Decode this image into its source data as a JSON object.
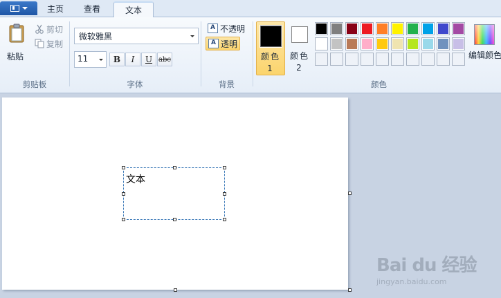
{
  "tabs": [
    {
      "label": "主页"
    },
    {
      "label": "查看"
    },
    {
      "label": "文本"
    }
  ],
  "clipboard": {
    "paste": "粘贴",
    "cut": "剪切",
    "copy": "复制",
    "group_label": "剪贴板"
  },
  "font": {
    "name": "微软雅黑",
    "size": "11",
    "bold": "B",
    "italic": "I",
    "underline": "U",
    "strikethrough": "abc",
    "group_label": "字体"
  },
  "background": {
    "opaque": "不透明",
    "transparent": "透明",
    "selected": "transparent",
    "group_label": "背景"
  },
  "colors": {
    "color1_label": "颜色 1",
    "color2_label": "颜色 2",
    "color1": "#000000",
    "color2": "#ffffff",
    "palette_row1": [
      "#000000",
      "#7f7f7f",
      "#880015",
      "#ed1c24",
      "#ff7f27",
      "#fff200",
      "#22b14c",
      "#00a2e8",
      "#3f48cc",
      "#a349a4"
    ],
    "palette_row2": [
      "#ffffff",
      "#c3c3c3",
      "#b97a57",
      "#ffaec9",
      "#ffc90e",
      "#efe4b0",
      "#b5e61d",
      "#99d9ea",
      "#7092be",
      "#c8bfe7"
    ],
    "edit_label": "编辑颜色",
    "group_label": "颜色"
  },
  "canvas": {
    "text_content": "文本"
  },
  "watermark": {
    "logo": "Bai du 经验",
    "url": "jingyan.baidu.com"
  }
}
